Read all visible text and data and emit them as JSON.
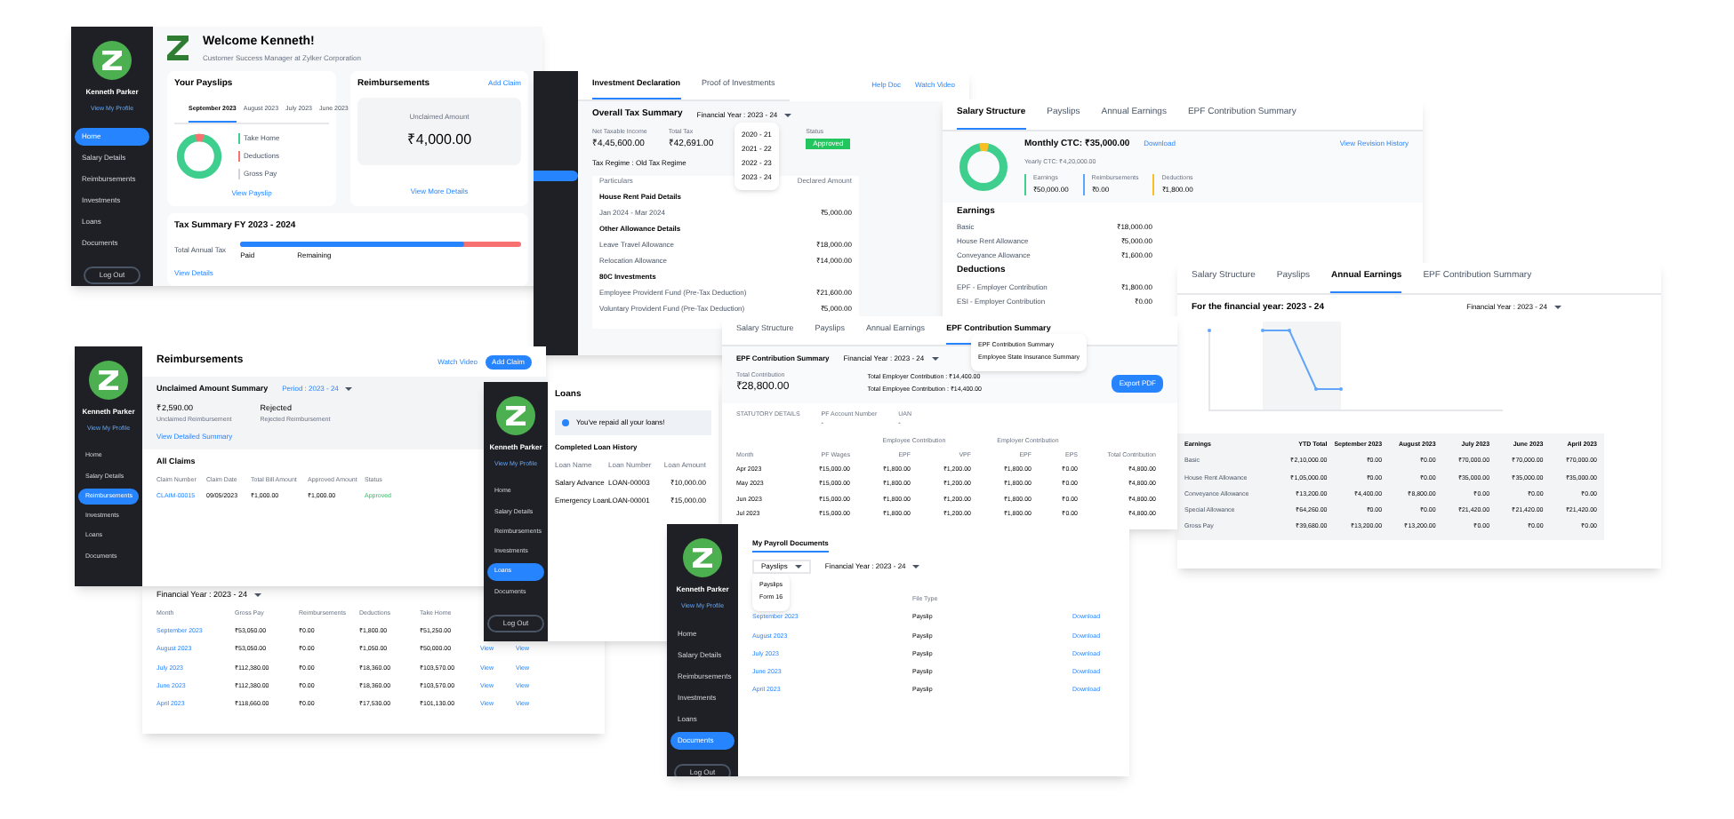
{
  "home": {
    "title": "Welcome Kenneth!",
    "subtitle": "Customer Success Manager at Zylker Corporation",
    "sidebar": {
      "name": "Kenneth Parker",
      "profile": "View My Profile",
      "items": [
        {
          "label": "Home",
          "selected": true
        },
        {
          "label": "Salary Details",
          "selected": false
        },
        {
          "label": "Reimbursements",
          "selected": false
        },
        {
          "label": "Investments",
          "selected": false
        },
        {
          "label": "Loans",
          "selected": false
        },
        {
          "label": "Documents",
          "selected": false
        }
      ],
      "logout": "Log Out"
    },
    "payslips": {
      "title": "Your Payslips",
      "tabs": [
        {
          "label": "September 2023",
          "selected": true
        },
        {
          "label": "August 2023",
          "selected": false
        },
        {
          "label": "July 2023",
          "selected": false
        },
        {
          "label": "June 2023",
          "selected": false
        }
      ],
      "legend": [
        {
          "label": "Take Home",
          "color": "#3ecf8e"
        },
        {
          "label": "Deductions",
          "color": "#f87171"
        },
        {
          "label": "Gross Pay",
          "color": "#d1d5db"
        }
      ],
      "link": "View Payslip"
    },
    "reimbursements": {
      "title": "Reimbursements",
      "action": "Add Claim",
      "caption": "Unclaimed Amount",
      "amount": "₹4,000.00",
      "link": "View More Details"
    },
    "tax": {
      "title": "Tax Summary  FY 2023 - 2024",
      "label": "Total Annual Tax",
      "paid": "Paid",
      "remaining": "Remaining",
      "level": 0.8,
      "link": "View Details"
    }
  },
  "investments": {
    "tabs": [
      {
        "label": "Investment Declaration",
        "selected": true
      },
      {
        "label": "Proof of Investments",
        "selected": false
      }
    ],
    "actions": [
      "Help Doc",
      "Watch Video"
    ],
    "summary_title": "Overall Tax Summary",
    "fy": "Financial Year : 2023 - 24",
    "years": [
      "2020 - 21",
      "2021 - 22",
      "2022 - 23",
      "2023 - 24"
    ],
    "stats": [
      {
        "label": "Net Taxable Income",
        "value": "₹4,45,600.00"
      },
      {
        "label": "Total Tax",
        "value": "₹42,691.00"
      }
    ],
    "status": {
      "label": "Status",
      "value": "Approved"
    },
    "regime": "Tax Regime : Old Tax Regime",
    "columns": [
      "Particulars",
      "Declared Amount"
    ],
    "sections": [
      {
        "label": "House Rent Paid Details",
        "rows": [
          {
            "label": "Jan 2024 - Mar 2024",
            "value": "₹5,000.00"
          }
        ]
      },
      {
        "label": "Other Allowance Details",
        "rows": [
          {
            "label": "Leave Travel Allowance",
            "value": "₹18,000.00"
          },
          {
            "label": "Relocation Allowance",
            "value": "₹14,000.00"
          }
        ]
      },
      {
        "label": "80C Investments",
        "rows": [
          {
            "label": "Employee Provident Fund (Pre-Tax Deduction)",
            "value": "₹21,600.00"
          },
          {
            "label": "Voluntary Provident Fund (Pre-Tax Deduction)",
            "value": "₹5,000.00"
          }
        ]
      }
    ]
  },
  "salary": {
    "tabs": [
      {
        "label": "Salary Structure",
        "selected": true
      },
      {
        "label": "Payslips",
        "selected": false
      },
      {
        "label": "Annual Earnings",
        "selected": false
      },
      {
        "label": "EPF Contribution Summary",
        "selected": false
      }
    ],
    "ctc": "Monthly CTC: ₹35,000.00",
    "yearly": "Yearly CTC: ₹4,20,000.00",
    "download": "Download",
    "history": "View Revision History",
    "tiles": [
      {
        "label": "Earnings",
        "value": "₹50,000.00",
        "color": "#3ecf8e"
      },
      {
        "label": "Reimbursements",
        "value": "₹0.00",
        "color": "#60a5fa"
      },
      {
        "label": "Deductions",
        "value": "₹1,800.00",
        "color": "#fbbf24"
      }
    ],
    "sections": [
      {
        "label": "Earnings",
        "rows": [
          {
            "label": "Basic",
            "value": "₹18,000.00"
          },
          {
            "label": "House Rent Allowance",
            "value": "₹5,000.00"
          },
          {
            "label": "Conveyance Allowance",
            "value": "₹1,600.00"
          }
        ]
      },
      {
        "label": "Deductions",
        "rows": [
          {
            "label": "EPF - Employer Contribution",
            "value": "₹1,800.00"
          },
          {
            "label": "ESI - Employer Contribution",
            "value": "₹0.00"
          }
        ]
      }
    ]
  },
  "annual": {
    "tabs": [
      {
        "label": "Salary Structure",
        "selected": false
      },
      {
        "label": "Payslips",
        "selected": false
      },
      {
        "label": "Annual Earnings",
        "selected": true
      },
      {
        "label": "EPF Contribution Summary",
        "selected": false
      }
    ],
    "heading": "For the financial year: 2023 - 24",
    "fy": "Financial Year : 2023 - 24",
    "columns": [
      "Earnings",
      "YTD Total",
      "September 2023",
      "August 2023",
      "July 2023",
      "June 2023",
      "April 2023"
    ],
    "rows": [
      [
        "Basic",
        "₹2,10,000.00",
        "₹0.00",
        "₹0.00",
        "₹70,000.00",
        "₹70,000.00",
        "₹70,000.00"
      ],
      [
        "House Rent Allowance",
        "₹1,05,000.00",
        "₹0.00",
        "₹0.00",
        "₹35,000.00",
        "₹35,000.00",
        "₹35,000.00"
      ],
      [
        "Conveyance Allowance",
        "₹13,200.00",
        "₹4,400.00",
        "₹8,800.00",
        "₹0.00",
        "₹0.00",
        "₹0.00"
      ],
      [
        "Special Allowance",
        "₹64,260.00",
        "₹0.00",
        "₹0.00",
        "₹21,420.00",
        "₹21,420.00",
        "₹21,420.00"
      ],
      [
        "Gross Pay",
        "₹39,680.00",
        "₹13,200.00",
        "₹13,200.00",
        "₹0.00",
        "₹0.00",
        "₹0.00"
      ]
    ]
  },
  "reimb": {
    "sidebar": {
      "name": "Kenneth Parker",
      "profile": "View My Profile",
      "items": [
        {
          "label": "Home",
          "selected": false
        },
        {
          "label": "Salary Details",
          "selected": false
        },
        {
          "label": "Reimbursements",
          "selected": true
        },
        {
          "label": "Investments",
          "selected": false
        },
        {
          "label": "Loans",
          "selected": false
        },
        {
          "label": "Documents",
          "selected": false
        }
      ]
    },
    "title": "Reimbursements",
    "watch": "Watch Video",
    "add": "Add Claim",
    "summary": "Unclaimed Amount Summary",
    "period": "Period : 2023 - 24",
    "stats": [
      {
        "value": "₹2,590.00",
        "label": "Unclaimed Reimbursement"
      },
      {
        "value": "Rejected",
        "label": "Rejected Reimbursement"
      }
    ],
    "link": "View Detailed Summary",
    "claims_title": "All Claims",
    "columns": [
      "Claim Number",
      "Claim Date",
      "Total Bill Amount",
      "Approved Amount",
      "Status"
    ],
    "rows": [
      [
        "CLAIM-00015",
        "09/05/2023",
        "₹1,000.00",
        "₹1,000.00",
        "Approved"
      ]
    ]
  },
  "payslip_table": {
    "fy": "Financial Year : 2023 - 24",
    "columns": [
      "Month",
      "Gross Pay",
      "Reimbursements",
      "Deductions",
      "Take Home"
    ],
    "rows": [
      [
        "September 2023",
        "₹53,050.00",
        "₹0.00",
        "₹1,800.00",
        "₹51,250.00"
      ],
      [
        "August 2023",
        "₹53,050.00",
        "₹0.00",
        "₹1,050.00",
        "₹50,000.00",
        "View",
        "View"
      ],
      [
        "July 2023",
        "₹112,380.00",
        "₹0.00",
        "₹18,360.00",
        "₹103,570.00",
        "View",
        "View"
      ],
      [
        "June 2023",
        "₹112,380.00",
        "₹0.00",
        "₹18,360.00",
        "₹103,570.00",
        "View",
        "View"
      ],
      [
        "April 2023",
        "₹118,660.00",
        "₹0.00",
        "₹17,530.00",
        "₹101,130.00",
        "View",
        "View"
      ]
    ]
  },
  "loans": {
    "sidebar": {
      "name": "Kenneth Parker",
      "profile": "View My Profile",
      "items": [
        {
          "label": "Home",
          "selected": false
        },
        {
          "label": "Salary Details",
          "selected": false
        },
        {
          "label": "Reimbursements",
          "selected": false
        },
        {
          "label": "Investments",
          "selected": false
        },
        {
          "label": "Loans",
          "selected": true
        },
        {
          "label": "Documents",
          "selected": false
        }
      ],
      "logout": "Log Out"
    },
    "title": "Loans",
    "notice": "You've repaid all your loans!",
    "history": "Completed Loan History",
    "columns": [
      "Loan Name",
      "Loan Number",
      "Loan Amount"
    ],
    "rows": [
      [
        "Salary Advance",
        "LOAN-00003",
        "₹10,000.00"
      ],
      [
        "Emergency Loan",
        "LOAN-00001",
        "₹15,000.00"
      ]
    ]
  },
  "epf": {
    "tabs": [
      {
        "label": "Salary Structure",
        "selected": false
      },
      {
        "label": "Payslips",
        "selected": false
      },
      {
        "label": "Annual Earnings",
        "selected": false
      },
      {
        "label": "EPF Contribution Summary",
        "selected": true
      }
    ],
    "menu": [
      "EPF Contribution Summary",
      "Employee State Insurance Summary"
    ],
    "title": "EPF Contribution Summary",
    "fy": "Financial Year : 2023 - 24",
    "total_label": "Total Contribution",
    "total": "₹28,800.00",
    "employer": "Total Employer Contribution : ₹14,400.00",
    "employee": "Total Employee Contribution : ₹14,400.00",
    "export": "Export PDF",
    "statutory": "STATUTORY DETAILS",
    "fields": [
      {
        "label": "PF Account Number",
        "value": "-"
      },
      {
        "label": "UAN",
        "value": "-"
      }
    ],
    "groups": [
      "Employee Contribution",
      "Employer Contribution"
    ],
    "columns": [
      "Month",
      "PF Wages",
      "EPF",
      "VPF",
      "EPF",
      "EPS",
      "Total Contribution"
    ],
    "rows": [
      [
        "Apr 2023",
        "₹15,000.00",
        "₹1,800.00",
        "₹1,200.00",
        "₹1,800.00",
        "₹0.00",
        "₹4,800.00"
      ],
      [
        "May 2023",
        "₹15,000.00",
        "₹1,800.00",
        "₹1,200.00",
        "₹1,800.00",
        "₹0.00",
        "₹4,800.00"
      ],
      [
        "Jun 2023",
        "₹15,000.00",
        "₹1,800.00",
        "₹1,200.00",
        "₹1,800.00",
        "₹0.00",
        "₹4,800.00"
      ],
      [
        "Jul 2023",
        "₹15,000.00",
        "₹1,800.00",
        "₹1,200.00",
        "₹1,800.00",
        "₹0.00",
        "₹4,800.00"
      ]
    ]
  },
  "documents": {
    "sidebar": {
      "name": "Kenneth Parker",
      "profile": "View My Profile",
      "items": [
        {
          "label": "Home",
          "selected": false
        },
        {
          "label": "Salary Details",
          "selected": false
        },
        {
          "label": "Reimbursements",
          "selected": false
        },
        {
          "label": "Investments",
          "selected": false
        },
        {
          "label": "Loans",
          "selected": false
        },
        {
          "label": "Documents",
          "selected": true
        }
      ],
      "logout": "Log Out"
    },
    "tab": "My Payroll Documents",
    "filter": "Payslips",
    "options": [
      "Payslips",
      "Form 16"
    ],
    "fy": "Financial Year : 2023 - 24",
    "column": "File Type",
    "rows": [
      [
        "September 2023",
        "Payslip",
        "Download"
      ],
      [
        "August 2023",
        "Payslip",
        "Download"
      ],
      [
        "July 2023",
        "Payslip",
        "Download"
      ],
      [
        "June 2023",
        "Payslip",
        "Download"
      ],
      [
        "April 2023",
        "Payslip",
        "Download"
      ]
    ]
  }
}
